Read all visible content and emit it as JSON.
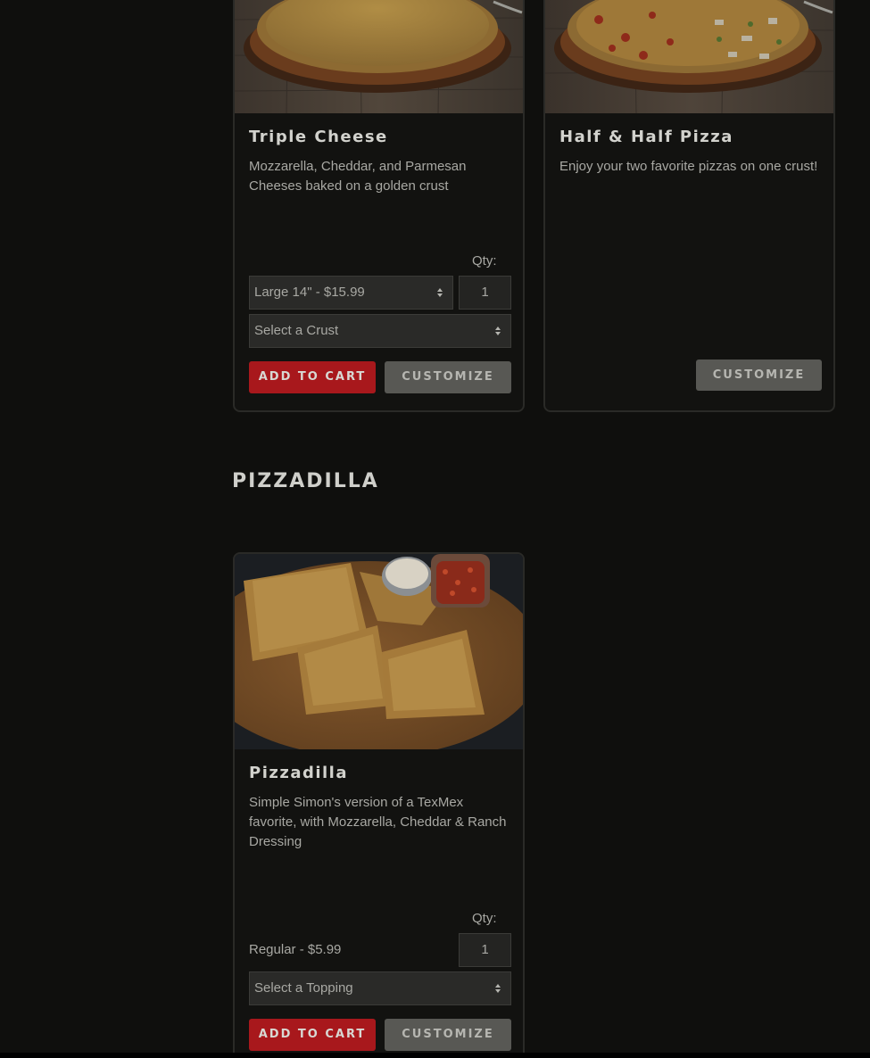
{
  "cards": {
    "triple_cheese": {
      "title": "Triple Cheese",
      "description": "Mozzarella, Cheddar, and Parmesan Cheeses baked on a golden crust",
      "qty_label": "Qty:",
      "size_select": "Large 14\" - $15.99",
      "qty_value": "1",
      "crust_select": "Select a Crust",
      "add_label": "ADD TO CART",
      "customize_label": "CUSTOMIZE"
    },
    "half_half": {
      "title": "Half & Half Pizza",
      "description": "Enjoy your two favorite pizzas on one crust!",
      "customize_label": "CUSTOMIZE"
    },
    "pizzadilla": {
      "title": "Pizzadilla",
      "description": "Simple Simon's version of a TexMex favorite, with Mozzarella, Cheddar & Ranch Dressing",
      "qty_label": "Qty:",
      "price": "Regular - $5.99",
      "qty_value": "1",
      "topping_select": "Select a Topping",
      "add_label": "ADD TO CART",
      "customize_label": "CUSTOMIZE"
    }
  },
  "sections": {
    "pizzadilla_heading": "PIZZADILLA"
  },
  "colors": {
    "background": "#0f0f0d",
    "add_button": "#a8181c",
    "customize_button": "#585854"
  },
  "icons": {
    "select_arrow": "select-updown-arrows-icon"
  }
}
